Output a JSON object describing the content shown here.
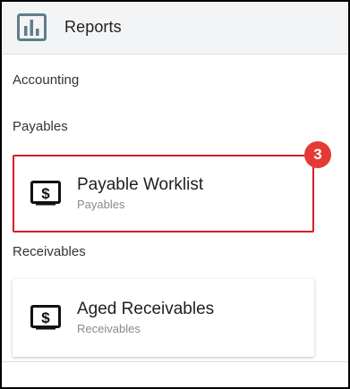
{
  "header": {
    "title": "Reports",
    "icon": "bar-chart-icon"
  },
  "groups": {
    "accounting": {
      "label": "Accounting"
    },
    "payables": {
      "label": "Payables"
    },
    "receivables": {
      "label": "Receivables"
    }
  },
  "cards": [
    {
      "title": "Payable Worklist",
      "subtitle": "Payables",
      "icon": "dollar-document-icon",
      "badge": "3"
    },
    {
      "title": "Aged Receivables",
      "subtitle": "Receivables",
      "icon": "dollar-document-icon"
    }
  ],
  "colors": {
    "highlight": "#d11f2b",
    "badge": "#e53935",
    "header_bg": "#f3f4f5",
    "icon": "#607d8b"
  }
}
